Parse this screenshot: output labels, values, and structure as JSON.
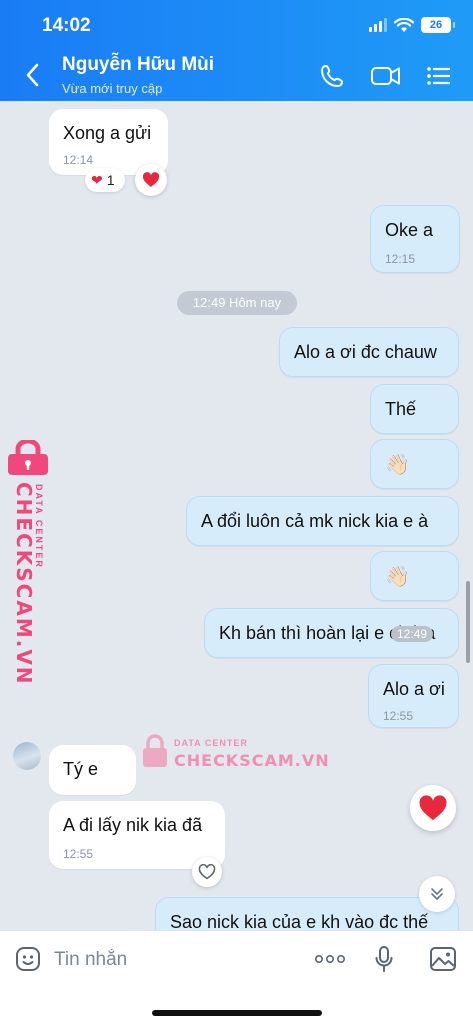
{
  "status_bar": {
    "time": "14:02",
    "battery": "26"
  },
  "header": {
    "contact_name": "Nguyễn Hữu Mùi",
    "contact_status": "Vừa mới truy cập"
  },
  "messages": [
    {
      "text": "Xong a gửi",
      "time": "12:14",
      "direction": "incoming",
      "reaction": "❤",
      "reaction_count": "1"
    },
    {
      "text": "Oke a",
      "time": "12:15",
      "direction": "outgoing"
    },
    {
      "divider": "12:49 Hôm nay"
    },
    {
      "text": "Alo a ơi đc chauw",
      "direction": "outgoing"
    },
    {
      "text": "Thế",
      "direction": "outgoing"
    },
    {
      "text": "👋🏻",
      "direction": "outgoing"
    },
    {
      "text": "A đổi luôn cả mk nick kia e à",
      "direction": "outgoing"
    },
    {
      "text": "👋🏻",
      "direction": "outgoing"
    },
    {
      "text": "Kh bán thì hoàn lại e chứ a",
      "time": "12:49",
      "direction": "outgoing"
    },
    {
      "text": "Alo a ơi",
      "time": "12:55",
      "direction": "outgoing"
    },
    {
      "text": "Tý e",
      "direction": "incoming"
    },
    {
      "text": "A đi lấy nik kia đã",
      "time": "12:55",
      "direction": "incoming"
    },
    {
      "text": "Sao nick kia của e kh vào đc thế",
      "direction": "outgoing"
    }
  ],
  "watermark": {
    "line1": "DATA CENTER",
    "line2": "CHECKSCAM.VN"
  },
  "input": {
    "placeholder": "Tin nhắn",
    "value": ""
  },
  "colors": {
    "header": "#1a7cf5",
    "outgoing_bubble": "#d7ecfb",
    "incoming_bubble": "#ffffff",
    "background": "#e3e8ef",
    "heart": "#e8283c",
    "watermark": "#f0487d"
  }
}
